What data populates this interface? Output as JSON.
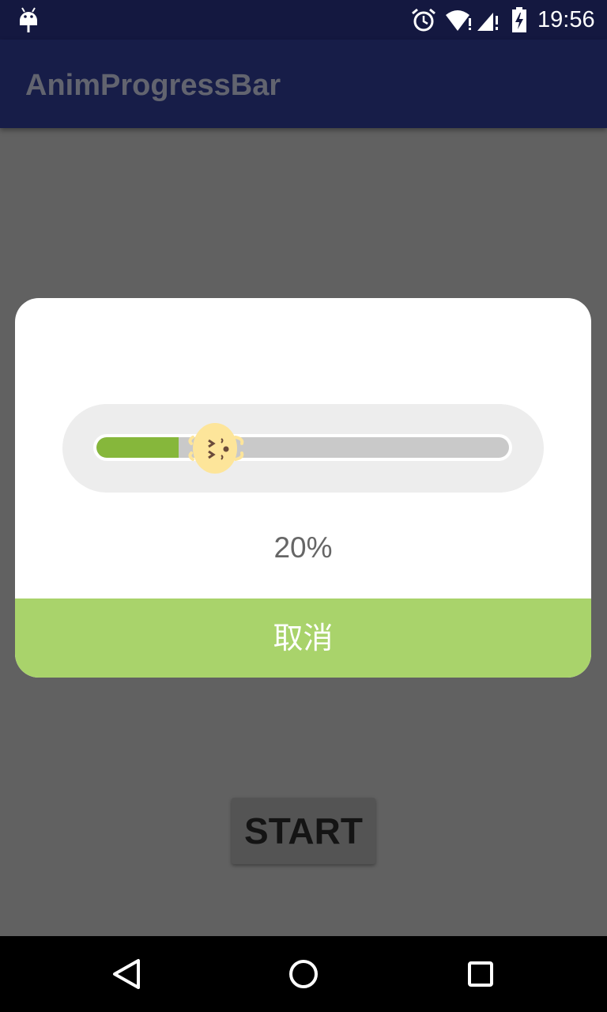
{
  "status_bar": {
    "time": "19:56",
    "icons": [
      "android-debug-icon",
      "alarm-icon",
      "wifi-icon",
      "signal-icon",
      "battery-charging-icon"
    ]
  },
  "app_bar": {
    "title": "AnimProgressBar"
  },
  "dialog": {
    "progress": 0.2,
    "percent_text": "20%",
    "cancel_label": "取消",
    "colors": {
      "fill": "#86b73b",
      "track": "#c9c9c9",
      "pill": "#ededed",
      "button": "#a9d36b",
      "mascot": "#fde59a"
    },
    "mascot_icon": "cat-face-icon"
  },
  "main": {
    "start_label": "START"
  },
  "nav_bar": {
    "icons": [
      "back-icon",
      "home-icon",
      "recents-icon"
    ]
  }
}
